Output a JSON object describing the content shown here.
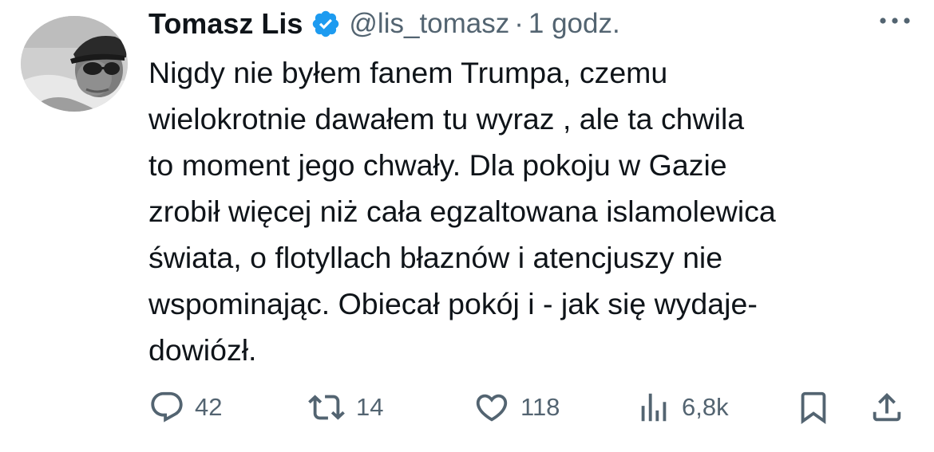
{
  "author": {
    "name": "Tomasz Lis",
    "handle": "@lis_tomasz",
    "separator": "·",
    "time": "1 godz.",
    "verified_color": "#1d9bf0"
  },
  "tweet": {
    "lines": [
      "Nigdy nie byłem fanem Trumpa, czemu",
      "wielokrotnie dawałem tu wyraz , ale ta chwila",
      "to moment jego chwały. Dla pokoju w Gazie",
      "zrobił więcej niż cała egzaltowana islamolewica",
      "świata, o flotyllach błaznów i atencjuszy nie",
      "wspominając. Obiecał pokój i - jak się wydaje-",
      "dowiózł."
    ]
  },
  "actions": {
    "replies": "42",
    "reposts": "14",
    "likes": "118",
    "views": "6,8k"
  },
  "icons": {
    "more": "more-dots-icon",
    "reply": "reply-bubble-icon",
    "repost": "repost-arrows-icon",
    "like": "heart-icon",
    "views": "views-bars-icon",
    "bookmark": "bookmark-icon",
    "share": "share-upload-icon"
  },
  "colors": {
    "text": "#0f1419",
    "secondary": "#536471",
    "icon": "#536471"
  }
}
